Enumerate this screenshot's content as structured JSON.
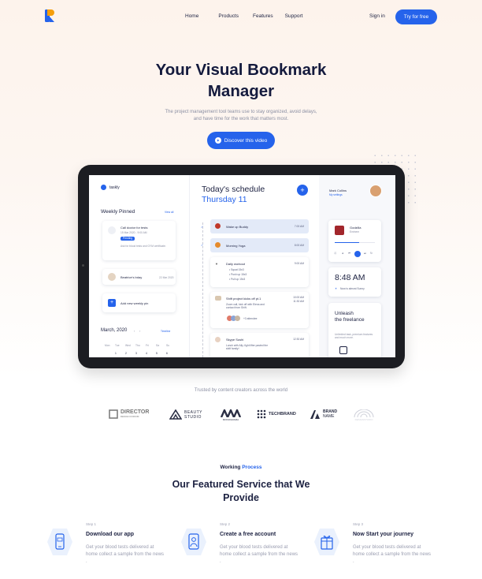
{
  "nav": {
    "links": [
      "Home",
      "Products",
      "Features",
      "Support"
    ],
    "signin": "Sign in",
    "cta": "Try for free"
  },
  "hero": {
    "title_line1": "Your Visual Bookmark",
    "title_line2": "Manager",
    "subtitle": "The project management tool teams use to stay organized, avoid delays, and have time for the work that matters most.",
    "cta": "Discover this video"
  },
  "app": {
    "brand": "taskly",
    "weekly_pinned": "Weekly Pinned",
    "view_all": "View all",
    "pinned_task": {
      "title": "Call doctor for tests",
      "date": "15 Mar 2020 - 9:00 AM",
      "badge": "Pending",
      "note": "Ask for blood tests and GYM certificate."
    },
    "birthday": {
      "title": "Beatrice's bday",
      "date": "22 Mar 2020"
    },
    "add_pin": "Add new weekly pin",
    "calendar": {
      "month": "March, 2020",
      "timeline": "Timeline",
      "days": [
        "Mon",
        "Tue",
        "Wed",
        "Thu",
        "Fri",
        "Sa",
        "Su"
      ],
      "row": [
        "1",
        "2",
        "3",
        "4",
        "5",
        "6"
      ]
    },
    "schedule_title": "Today's schedule",
    "schedule_day": "Thursday 11",
    "schedule": [
      {
        "title": "Wake up Buddy",
        "time": "7:00 AM",
        "done": true
      },
      {
        "title": "Morning Yoga",
        "time": "8:00 AM",
        "done": true
      },
      {
        "title": "Daily workout",
        "time": "9:00 AM",
        "items": [
          "Squat 15x3",
          "Push up 15x3",
          "Pull up 15x3"
        ]
      },
      {
        "title": "Shift project kicks off pt.1",
        "time": "10:00 AM",
        "time2": "11:30 AM",
        "note": "Zoom call, kick off with Elena and contact from Shift.",
        "extra": "+3 attendee"
      },
      {
        "title": "Skype Sushi",
        "time": "12:30 AM",
        "note": "Lunch with Ally, fight lifter pasted the shift family!"
      }
    ],
    "user": {
      "name": "Mark Collins",
      "link": "My settings"
    },
    "music": {
      "title": "Godzilla",
      "artist": "Eminem"
    },
    "clock": {
      "time": "8:48 AM",
      "note": "Now is almost Sunny"
    },
    "promo": {
      "title_line1": "Unleash",
      "title_line2": "the freelance",
      "text": "Unlimited task, premium features and much more."
    }
  },
  "trusted": "Trusted by content creators across the world",
  "brands": [
    {
      "name": "DIRECTOR",
      "sub": "DESIGN FORUM"
    },
    {
      "name": "BEAUTY",
      "sub": "STUDIO"
    },
    {
      "name": "MONOGRAMA",
      "sub": ""
    },
    {
      "name": "TECHBRAND",
      "sub": ""
    },
    {
      "name": "BRAND",
      "sub": "NAME"
    },
    {
      "name": "WAVE",
      "sub": "DESIGNSTUDIO"
    }
  ],
  "process": {
    "eyebrow_a": "Working",
    "eyebrow_b": "Process",
    "title_line1": "Our Featured Service that We",
    "title_line2": "Provide",
    "steps": [
      {
        "step": "Step 1",
        "title": "Download our app",
        "desc": "Get your blood tests delivered at home collect a sample from the news ."
      },
      {
        "step": "Step 2",
        "title": "Create a free account",
        "desc": "Get your blood tests delivered at home collect a sample from the news ."
      },
      {
        "step": "Step 3",
        "title": "Now Start your journey",
        "desc": "Get your blood tests delivered at home collect a sample from the news ."
      }
    ]
  },
  "colors": {
    "accent": "#2563eb",
    "heading": "#141a3d",
    "muted": "#8b8fa3",
    "hero_bg": "#fdf3ec"
  }
}
